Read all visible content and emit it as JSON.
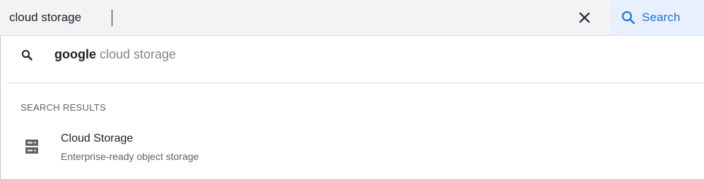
{
  "search": {
    "query": "cloud storage",
    "clear_icon": "close-icon",
    "button_label": "Search",
    "button_icon": "search-icon"
  },
  "suggestion": {
    "icon": "search-icon",
    "bold_prefix": "google",
    "rest": " cloud storage"
  },
  "results_section": {
    "heading": "SEARCH RESULTS",
    "items": [
      {
        "icon": "storage-icon",
        "title": "Cloud Storage",
        "subtitle": "Enterprise-ready object storage"
      }
    ]
  },
  "colors": {
    "accent": "#1a73e8",
    "search_button_bg": "#e8f0fe",
    "search_bar_bg": "#f1f3f4"
  }
}
